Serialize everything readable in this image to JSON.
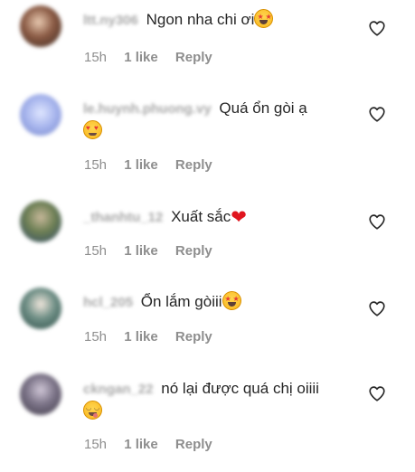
{
  "comments": [
    {
      "username": "ltt.ny306",
      "text": "Ngon nha chi ơi",
      "emoji": "star-struck",
      "time": "15h",
      "likes": "1 like",
      "reply": "Reply",
      "avatar_color": "#6b4a3a"
    },
    {
      "username": "le.huynh.phuong.vy",
      "text": "Quá ổn gòi ạ",
      "emoji": "smiling-face-with-hearts",
      "time": "15h",
      "likes": "1 like",
      "reply": "Reply",
      "avatar_color": "#9aa9e0"
    },
    {
      "username": "_thanhtu_12",
      "text": "Xuất sắc",
      "emoji": "red-heart",
      "time": "15h",
      "likes": "1 like",
      "reply": "Reply",
      "avatar_color": "#5f7a4a"
    },
    {
      "username": "hcl_205",
      "text": "Ổn lắm gòiii",
      "emoji": "star-struck",
      "time": "15h",
      "likes": "1 like",
      "reply": "Reply",
      "avatar_color": "#3e6a5e"
    },
    {
      "username": "ckngan_22",
      "text": "nó lại được quá chị oiiii",
      "emoji": "face-savoring-food",
      "time": "15h",
      "likes": "1 like",
      "reply": "Reply",
      "avatar_color": "#6e6876"
    }
  ]
}
